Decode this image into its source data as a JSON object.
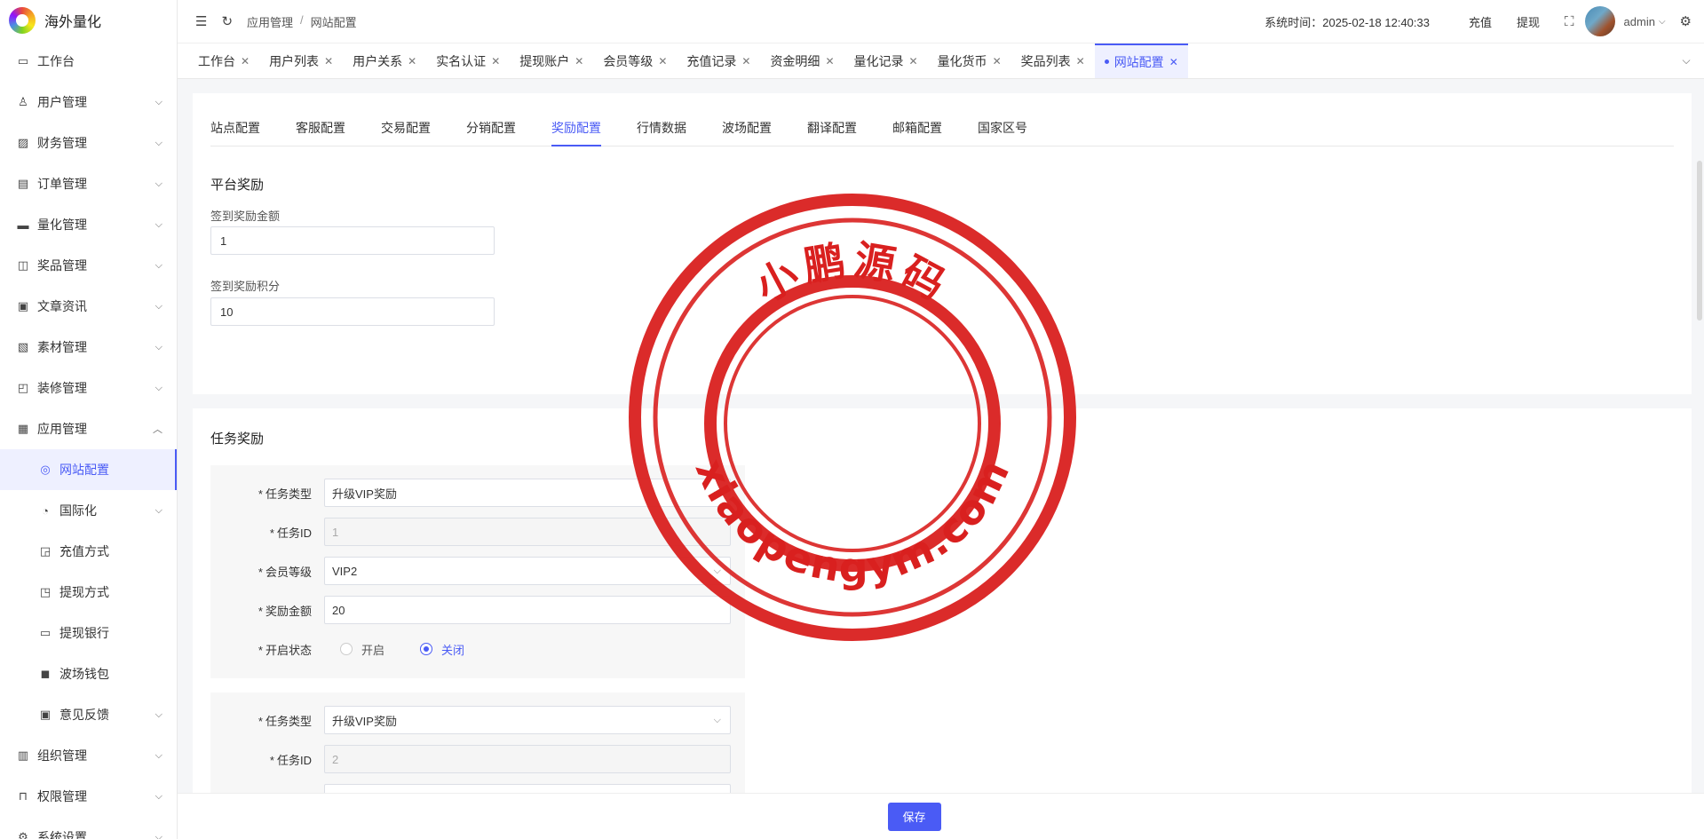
{
  "brand": {
    "name": "海外量化"
  },
  "sidebar": {
    "items": [
      {
        "label": "工作台",
        "icon": "monitor-icon",
        "glyph": "▭",
        "chevron": ""
      },
      {
        "label": "用户管理",
        "icon": "user-icon",
        "glyph": "♙",
        "chevron": "⌵"
      },
      {
        "label": "财务管理",
        "icon": "chart-icon",
        "glyph": "▨",
        "chevron": "⌵"
      },
      {
        "label": "订单管理",
        "icon": "order-icon",
        "glyph": "▤",
        "chevron": "⌵"
      },
      {
        "label": "量化管理",
        "icon": "quant-icon",
        "glyph": "▬",
        "chevron": "⌵"
      },
      {
        "label": "奖品管理",
        "icon": "gift-bag-icon",
        "glyph": "◫",
        "chevron": "⌵"
      },
      {
        "label": "文章资讯",
        "icon": "article-icon",
        "glyph": "▣",
        "chevron": "⌵"
      },
      {
        "label": "素材管理",
        "icon": "image-icon",
        "glyph": "▧",
        "chevron": "⌵"
      },
      {
        "label": "装修管理",
        "icon": "decor-icon",
        "glyph": "◰",
        "chevron": "⌵"
      },
      {
        "label": "应用管理",
        "icon": "app-icon",
        "glyph": "▦",
        "chevron": "︿"
      },
      {
        "label": "网站配置",
        "icon": "website-icon",
        "glyph": "◎",
        "chevron": "",
        "sub": true,
        "active": true
      },
      {
        "label": "国际化",
        "icon": "globe-icon",
        "glyph": "◔",
        "chevron": "⌵",
        "sub": true
      },
      {
        "label": "充值方式",
        "icon": "recharge-icon",
        "glyph": "◲",
        "chevron": "",
        "sub": true
      },
      {
        "label": "提现方式",
        "icon": "withdraw-icon",
        "glyph": "◳",
        "chevron": "",
        "sub": true
      },
      {
        "label": "提现银行",
        "icon": "bank-card-icon",
        "glyph": "▭",
        "chevron": "",
        "sub": true
      },
      {
        "label": "波场钱包",
        "icon": "wallet-icon",
        "glyph": "◼",
        "chevron": "",
        "sub": true
      },
      {
        "label": "意见反馈",
        "icon": "feedback-icon",
        "glyph": "▣",
        "chevron": "⌵",
        "sub": true
      },
      {
        "label": "组织管理",
        "icon": "org-icon",
        "glyph": "▥",
        "chevron": "⌵"
      },
      {
        "label": "权限管理",
        "icon": "lock-icon",
        "glyph": "⊓",
        "chevron": "⌵"
      },
      {
        "label": "系统设置",
        "icon": "settings-icon",
        "glyph": "⚙",
        "chevron": "⌵"
      }
    ]
  },
  "header": {
    "breadcrumb": [
      "应用管理",
      "网站配置"
    ],
    "breadcrumb_sep": "/",
    "system_time": "系统时间：2025-02-18 12:40:33",
    "recharge": "充值",
    "withdraw": "提现",
    "user": "admin"
  },
  "tabs": [
    {
      "label": "工作台"
    },
    {
      "label": "用户列表"
    },
    {
      "label": "用户关系"
    },
    {
      "label": "实名认证"
    },
    {
      "label": "提现账户"
    },
    {
      "label": "会员等级"
    },
    {
      "label": "充值记录"
    },
    {
      "label": "资金明细"
    },
    {
      "label": "量化记录"
    },
    {
      "label": "量化货币"
    },
    {
      "label": "奖品列表"
    },
    {
      "label": "网站配置",
      "active": true
    }
  ],
  "subtabs": [
    {
      "label": "站点配置"
    },
    {
      "label": "客服配置"
    },
    {
      "label": "交易配置"
    },
    {
      "label": "分销配置"
    },
    {
      "label": "奖励配置",
      "active": true
    },
    {
      "label": "行情数据"
    },
    {
      "label": "波场配置"
    },
    {
      "label": "翻译配置"
    },
    {
      "label": "邮箱配置"
    },
    {
      "label": "国家区号"
    }
  ],
  "platform_reward": {
    "title": "平台奖励",
    "signin_amount_label": "签到奖励金额",
    "signin_amount_value": "1",
    "signin_points_label": "签到奖励积分",
    "signin_points_value": "10"
  },
  "task_reward": {
    "title": "任务奖励",
    "labels": {
      "type": "任务类型",
      "id": "任务ID",
      "level": "会员等级",
      "amount": "奖励金额",
      "status": "开启状态",
      "on": "开启",
      "off": "关闭"
    },
    "tasks": [
      {
        "type": "升级VIP奖励",
        "id": "1",
        "level": "VIP2",
        "amount": "20",
        "status": "off"
      },
      {
        "type": "升级VIP奖励",
        "id": "2"
      }
    ]
  },
  "footer": {
    "save": "保存"
  },
  "watermark": {
    "top_text": "小鹏源码",
    "bottom_text": "xiaopengym.com",
    "color": "#d9201f"
  }
}
